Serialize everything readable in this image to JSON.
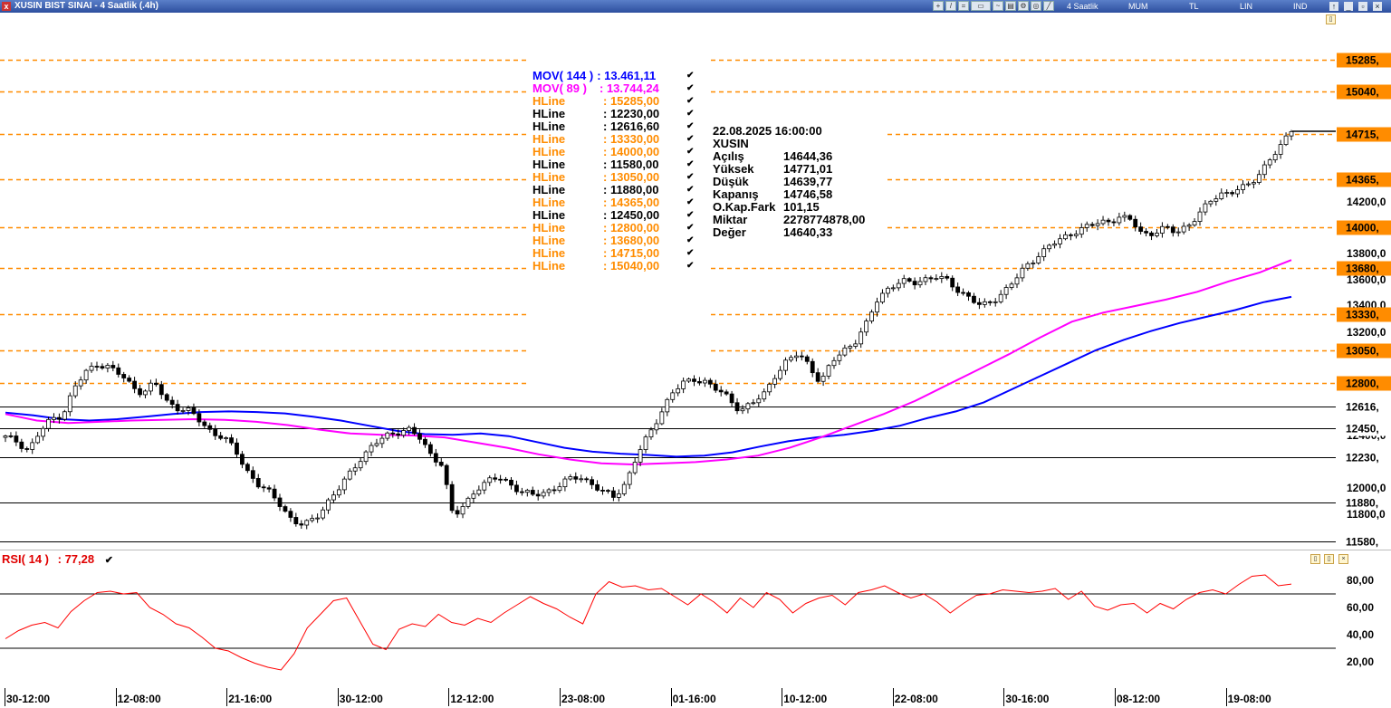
{
  "window": {
    "title": "XUSIN BIST SINAI - 4 Saatlik (.4h)",
    "period_label": "4 Saatlik",
    "candle_type": "MUM",
    "currency": "TL",
    "scale": "LIN",
    "mode": "IND"
  },
  "legend": [
    {
      "name": "MOV( 144 )",
      "value": ": 13.461,11",
      "color": "#0000ff"
    },
    {
      "name": "MOV( 89 )",
      "value": ": 13.744,24",
      "color": "#ff00ff"
    },
    {
      "name": "HLine",
      "value": ": 15285,00",
      "color": "#ff8c00"
    },
    {
      "name": "HLine",
      "value": ": 12230,00",
      "color": "#000000"
    },
    {
      "name": "HLine",
      "value": ": 12616,60",
      "color": "#000000"
    },
    {
      "name": "HLine",
      "value": ": 13330,00",
      "color": "#ff8c00"
    },
    {
      "name": "HLine",
      "value": ": 14000,00",
      "color": "#ff8c00"
    },
    {
      "name": "HLine",
      "value": ": 11580,00",
      "color": "#000000"
    },
    {
      "name": "HLine",
      "value": ": 13050,00",
      "color": "#ff8c00"
    },
    {
      "name": "HLine",
      "value": ": 11880,00",
      "color": "#000000"
    },
    {
      "name": "HLine",
      "value": ": 14365,00",
      "color": "#ff8c00"
    },
    {
      "name": "HLine",
      "value": ": 12450,00",
      "color": "#000000"
    },
    {
      "name": "HLine",
      "value": ": 12800,00",
      "color": "#ff8c00"
    },
    {
      "name": "HLine",
      "value": ": 13680,00",
      "color": "#ff8c00"
    },
    {
      "name": "HLine",
      "value": ": 14715,00",
      "color": "#ff8c00"
    },
    {
      "name": "HLine",
      "value": ": 15040,00",
      "color": "#ff8c00"
    }
  ],
  "info_box": {
    "datetime": "22.08.2025  16:00:00",
    "symbol": "XUSIN",
    "rows": [
      {
        "label": "Açılış",
        "value": "14644,36"
      },
      {
        "label": "Yüksek",
        "value": "14771,01"
      },
      {
        "label": "Düşük",
        "value": "14639,77"
      },
      {
        "label": "Kapanış",
        "value": "14746,58"
      },
      {
        "label": "O.Kap.Fark",
        "value": "101,15"
      },
      {
        "label": "Miktar",
        "value": "2278774878,00"
      },
      {
        "label": "Değer",
        "value": "14640,33"
      }
    ]
  },
  "rsi": {
    "label": "RSI( 14 )",
    "value": ": 77,28",
    "color": "#ff0000"
  },
  "chart_data": {
    "type": "candlestick",
    "y_ticks": [
      "14200,0",
      "13800,0",
      "13600,0",
      "13400,0",
      "13200,0",
      "12400,0",
      "12000,0",
      "11800,0"
    ],
    "hlines": [
      {
        "value": 15285,
        "label": "15285,",
        "color": "#ff8c00",
        "style": "dashed"
      },
      {
        "value": 15040,
        "label": "15040,",
        "color": "#ff8c00",
        "style": "dashed"
      },
      {
        "value": 14715,
        "label": "14715,",
        "color": "#ff8c00",
        "style": "dashed"
      },
      {
        "value": 14365,
        "label": "14365,",
        "color": "#ff8c00",
        "style": "dashed"
      },
      {
        "value": 14000,
        "label": "14000,",
        "color": "#ff8c00",
        "style": "dashed"
      },
      {
        "value": 13680,
        "label": "13680,",
        "color": "#ff8c00",
        "style": "dashed"
      },
      {
        "value": 13330,
        "label": "13330,",
        "color": "#ff8c00",
        "style": "dashed"
      },
      {
        "value": 13050,
        "label": "13050,",
        "color": "#ff8c00",
        "style": "dashed"
      },
      {
        "value": 12800,
        "label": "12800,",
        "color": "#ff8c00",
        "style": "dashed"
      },
      {
        "value": 12616.6,
        "label": "12616,",
        "color": "#000000",
        "style": "solid"
      },
      {
        "value": 12450,
        "label": "12450,",
        "color": "#000000",
        "style": "solid"
      },
      {
        "value": 12230,
        "label": "12230,",
        "color": "#000000",
        "style": "solid"
      },
      {
        "value": 11880,
        "label": "11880,",
        "color": "#000000",
        "style": "solid"
      },
      {
        "value": 11580,
        "label": "11580,",
        "color": "#000000",
        "style": "solid"
      }
    ],
    "x_labels": [
      "30-12:00",
      "12-08:00",
      "21-16:00",
      "30-12:00",
      "12-12:00",
      "23-08:00",
      "01-16:00",
      "10-12:00",
      "22-08:00",
      "30-16:00",
      "08-12:00",
      "19-08:00"
    ],
    "close_path": [
      12380,
      12350,
      12280,
      12420,
      12520,
      12560,
      12760,
      12880,
      12950,
      12920,
      12860,
      12780,
      12720,
      12800,
      12660,
      12610,
      12580,
      12500,
      12420,
      12380,
      12280,
      12130,
      12020,
      11950,
      11860,
      11740,
      11700,
      11760,
      11880,
      11980,
      12100,
      12230,
      12320,
      12380,
      12420,
      12450,
      12380,
      12250,
      12180,
      11760,
      11860,
      11990,
      12040,
      12070,
      12020,
      11960,
      11930,
      11960,
      12000,
      12050,
      12080,
      12030,
      11960,
      11920,
      12030,
      12240,
      12390,
      12560,
      12720,
      12790,
      12830,
      12810,
      12740,
      12680,
      12590,
      12640,
      12700,
      12860,
      12960,
      13020,
      12940,
      12800,
      12960,
      13050,
      13120,
      13250,
      13450,
      13540,
      13580,
      13560,
      13600,
      13620,
      13580,
      13510,
      13460,
      13380,
      13430,
      13510,
      13600,
      13700,
      13790,
      13860,
      13900,
      13960,
      14000,
      14020,
      14040,
      14080,
      14050,
      13940,
      13960,
      13990,
      13950,
      14020,
      14100,
      14200,
      14260,
      14280,
      14300,
      14380,
      14520,
      14600,
      14746.58
    ],
    "mov144": [
      12570,
      12550,
      12520,
      12510,
      12520,
      12540,
      12560,
      12575,
      12580,
      12575,
      12565,
      12540,
      12510,
      12470,
      12430,
      12405,
      12400,
      12410,
      12390,
      12345,
      12300,
      12270,
      12255,
      12245,
      12232,
      12240,
      12265,
      12310,
      12350,
      12380,
      12400,
      12430,
      12470,
      12530,
      12580,
      12650,
      12750,
      12850,
      12950,
      13050,
      13130,
      13200,
      13260,
      13310,
      13360,
      13420,
      13461.11
    ],
    "mov89": [
      12560,
      12510,
      12490,
      12500,
      12510,
      12515,
      12520,
      12515,
      12500,
      12475,
      12440,
      12410,
      12400,
      12395,
      12380,
      12340,
      12300,
      12250,
      12210,
      12180,
      12172,
      12180,
      12190,
      12210,
      12240,
      12300,
      12380,
      12470,
      12560,
      12660,
      12780,
      12900,
      13020,
      13150,
      13270,
      13340,
      13390,
      13440,
      13500,
      13580,
      13650,
      13744.24
    ],
    "rsi_path": [
      37,
      43,
      47,
      49,
      45,
      57,
      65,
      71,
      72,
      70,
      71,
      60,
      55,
      48,
      45,
      38,
      30,
      28,
      23,
      19,
      16,
      14,
      26,
      45,
      55,
      65,
      67,
      50,
      33,
      29,
      44,
      48,
      46,
      55,
      49,
      47,
      52,
      49,
      56,
      62,
      68,
      63,
      59,
      53,
      48,
      70,
      79,
      75,
      76,
      73,
      74,
      68,
      62,
      70,
      64,
      56,
      67,
      60,
      71,
      66,
      56,
      63,
      67,
      69,
      62,
      71,
      73,
      76,
      71,
      67,
      70,
      64,
      56,
      63,
      69,
      70,
      73,
      72,
      71,
      72,
      74,
      66,
      72,
      61,
      58,
      62,
      63,
      56,
      63,
      59,
      66,
      71,
      73,
      70,
      77,
      83,
      84,
      76,
      77.28
    ],
    "rsi_ticks": [
      "80,00",
      "60,00",
      "40,00",
      "20,00"
    ]
  }
}
